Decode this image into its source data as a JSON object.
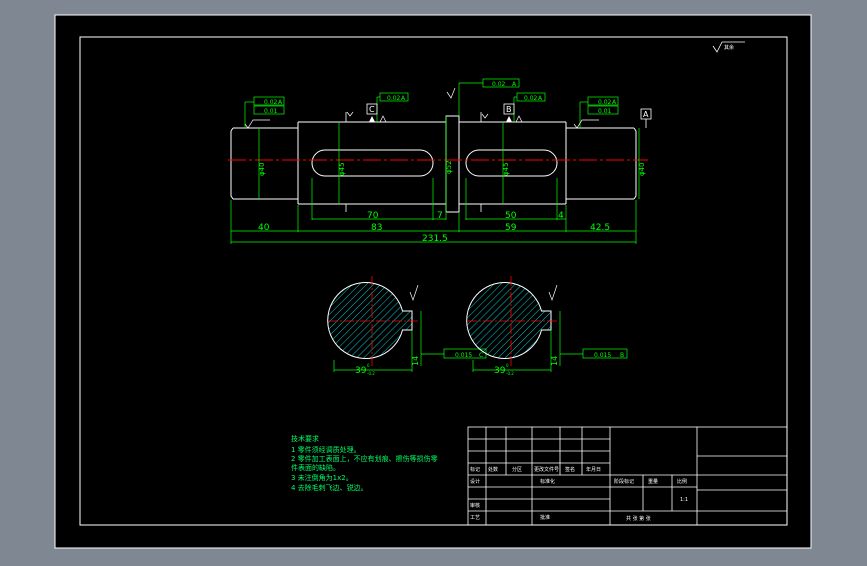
{
  "colors": {
    "background": "#000000",
    "frame": "#ffffff",
    "dimension": "#00ff00",
    "centerline": "#ff0000",
    "hatch": "#00ffff",
    "geometry": "#ffffff",
    "label_green": "#00ff66"
  },
  "drawing": {
    "dims_bottom": {
      "d40": "40",
      "d70": "70",
      "d83": "83",
      "d7": "7",
      "d50": "50",
      "d59": "59",
      "d4": "4",
      "d42_5": "42.5",
      "d231_5": "231.5"
    },
    "diameters": {
      "left_journal": "φ40",
      "left_keyway": "φ45",
      "collar": "φ52",
      "right_keyway": "φ45",
      "right_journal": "φ40"
    },
    "datums": {
      "c": "C",
      "b": "B",
      "a": "A"
    },
    "tolerances": {
      "tol1": "0.02",
      "tol1_ref": "A",
      "tol2": "0.01",
      "tol3": "0.02",
      "tol3_ref": "A",
      "tol4": "0.02",
      "tol4_ref": "A",
      "tol5": "0.02",
      "tol5_ref": "A",
      "tol6": "0.02",
      "tol6_ref": "A",
      "tol7": "0.01"
    },
    "sections": {
      "left_dim": "39",
      "left_sup": "0",
      "left_sub": "-0.2",
      "left_depth": "14",
      "left_tol": "0.015",
      "left_tol_ref": "C",
      "right_dim": "39",
      "right_sup": "0",
      "right_sub": "-0.2",
      "right_depth": "14",
      "right_tol": "0.015",
      "right_tol_ref": "B"
    },
    "tech_req": {
      "title": "技术要求",
      "line1": "1  零件须经调质处理。",
      "line2": "2  零件加工表面上，不应有划痕、擦伤等损伤零",
      "line2b": "件表面的缺陷。",
      "line3": "3  未注倒角为1x2。",
      "line4": "4  去除毛刺飞边、锐边。"
    },
    "title_block": {
      "r1c1": "标记",
      "r1c2": "处数",
      "r1c3": "分区",
      "r1c4": "更改文件号",
      "r1c5": "签名",
      "r1c6": "年月日",
      "r2c1": "设计",
      "r2c4": "标准化",
      "r2c7": "阶段标记",
      "r2c8": "重量",
      "r2c9": "比例",
      "r3c1": "审核",
      "r4c1": "工艺",
      "r4c4": "批准",
      "bottom_row": "共  张   第  张",
      "scale": "1:1"
    },
    "roughness_label": "其余"
  }
}
